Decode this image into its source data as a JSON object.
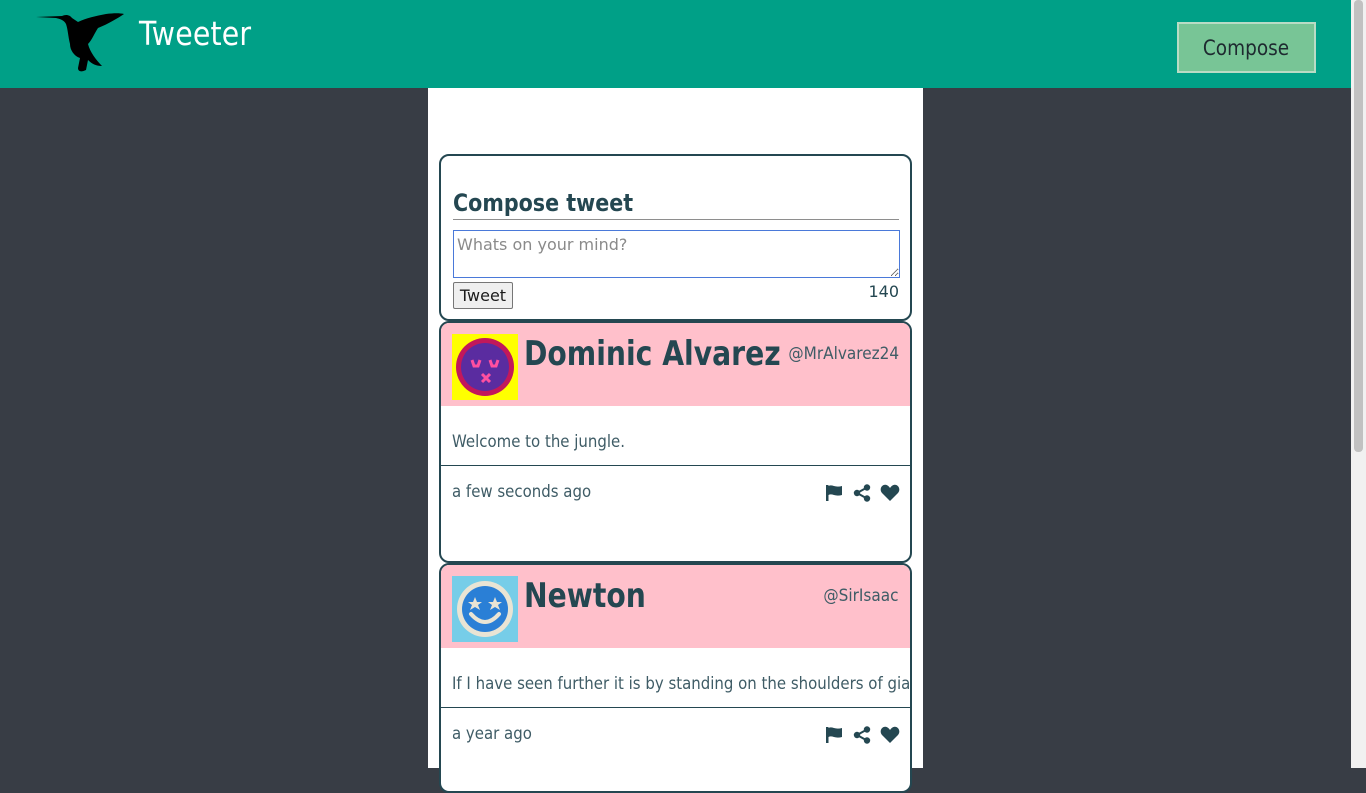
{
  "header": {
    "brand": "Tweeter",
    "compose_label": "Compose",
    "logo_icon": "hummingbird-icon"
  },
  "compose": {
    "title": "Compose tweet",
    "placeholder": "Whats on your mind?",
    "submit_label": "Tweet",
    "counter": "140"
  },
  "tweets": [
    {
      "name": "Dominic Alvarez",
      "handle": "@MrAlvarez24",
      "text": "Welcome to the jungle.",
      "time": "a few seconds ago",
      "avatar_icon": "dizzy-face-avatar-icon"
    },
    {
      "name": "Newton",
      "handle": "@SirIsaac",
      "text": "If I have seen further it is by standing on the shoulders of giants",
      "time": "a year ago",
      "avatar_icon": "star-eyes-smiley-avatar-icon"
    }
  ],
  "actions": [
    "flag-icon",
    "share-icon",
    "heart-icon"
  ],
  "colors": {
    "nav": "#00a087",
    "background": "#383d45",
    "card_header": "#ffc0cb",
    "text": "#244751",
    "compose_button": "#78c596"
  }
}
